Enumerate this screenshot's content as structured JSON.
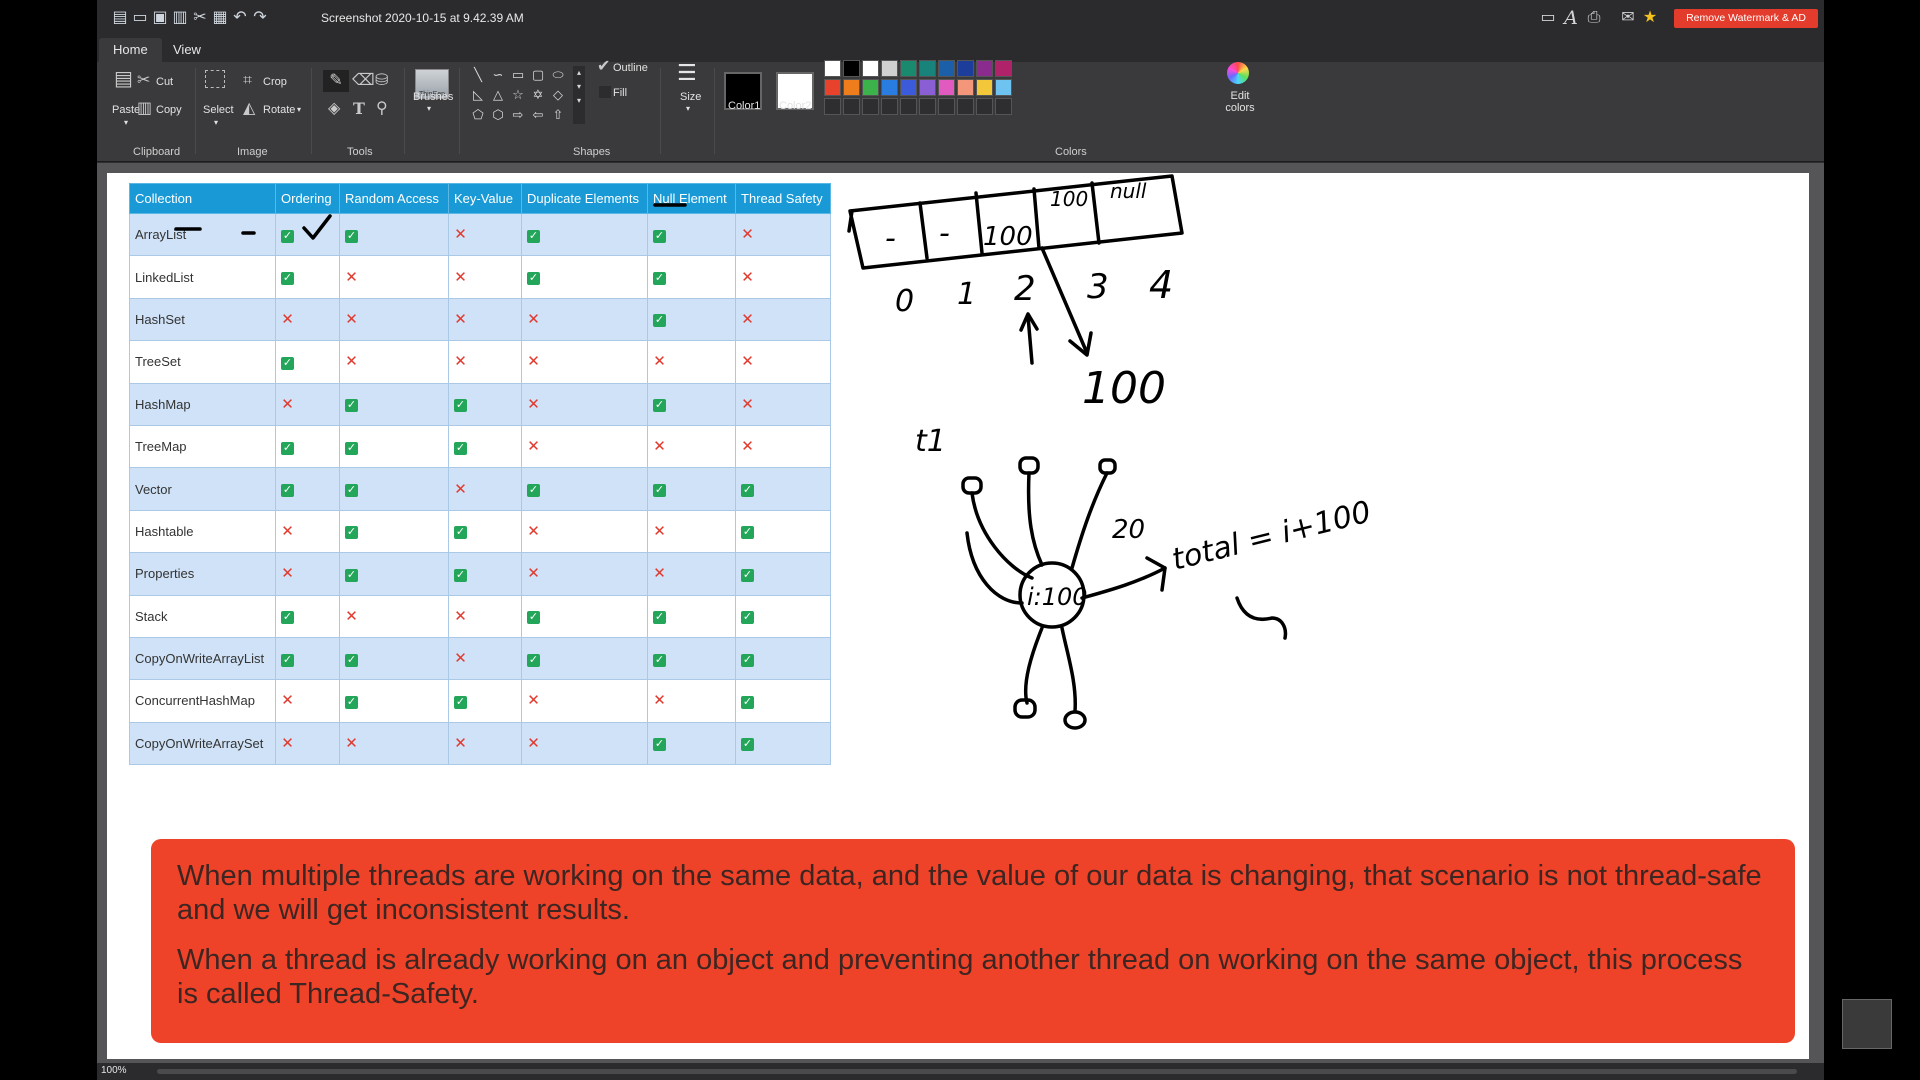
{
  "title": "Screenshot 2020-10-15 at 9.42.39 AM",
  "watermark_button": "Remove Watermark & AD",
  "menu_tabs": [
    "Home",
    "View"
  ],
  "ribbon": {
    "clipboard": {
      "paste": "Paste",
      "cut": "Cut",
      "copy": "Copy",
      "group": "Clipboard"
    },
    "image": {
      "select": "Select",
      "crop": "Crop",
      "rotate": "Rotate",
      "group": "Image"
    },
    "tools": {
      "group": "Tools"
    },
    "brushes": {
      "label": "Brushes",
      "preview": "ThinPen"
    },
    "shapes": {
      "group": "Shapes",
      "outline": "Outline",
      "fill": "Fill"
    },
    "size": {
      "label": "Size"
    },
    "colors": {
      "color1": "Color1",
      "color2": "Color2",
      "edit": "Edit colors",
      "group": "Colors"
    }
  },
  "palette_row1": [
    "#ffffff",
    "#000000",
    "#ffffff",
    "#d0d0d0",
    "#1a8a6e",
    "#17837a",
    "#1b5fa8",
    "#1d3d9a",
    "#8a2b8d",
    "#b0236b"
  ],
  "palette_row2": [
    "#e8412c",
    "#f07d1c",
    "#3cb24a",
    "#2a7de0",
    "#3b5bdb",
    "#8a5fd6",
    "#e05ac0",
    "#f3967a",
    "#f3c73a",
    "#6fc3f0"
  ],
  "table": {
    "headers": [
      "Collection",
      "Ordering",
      "Random Access",
      "Key-Value",
      "Duplicate Elements",
      "Null Element",
      "Thread Safety"
    ],
    "rows": [
      {
        "name": "ArrayList",
        "v": [
          1,
          1,
          0,
          1,
          1,
          0
        ]
      },
      {
        "name": "LinkedList",
        "v": [
          1,
          0,
          0,
          1,
          1,
          0
        ]
      },
      {
        "name": "HashSet",
        "v": [
          0,
          0,
          0,
          0,
          1,
          0
        ]
      },
      {
        "name": "TreeSet",
        "v": [
          1,
          0,
          0,
          0,
          0,
          0
        ]
      },
      {
        "name": "HashMap",
        "v": [
          0,
          1,
          1,
          0,
          1,
          0
        ]
      },
      {
        "name": "TreeMap",
        "v": [
          1,
          1,
          1,
          0,
          0,
          0
        ]
      },
      {
        "name": "Vector",
        "v": [
          1,
          1,
          0,
          1,
          1,
          1
        ]
      },
      {
        "name": "Hashtable",
        "v": [
          0,
          1,
          1,
          0,
          0,
          1
        ]
      },
      {
        "name": "Properties",
        "v": [
          0,
          1,
          1,
          0,
          0,
          1
        ]
      },
      {
        "name": "Stack",
        "v": [
          1,
          0,
          0,
          1,
          1,
          1
        ]
      },
      {
        "name": "CopyOnWriteArrayList",
        "v": [
          1,
          1,
          0,
          1,
          1,
          1
        ]
      },
      {
        "name": "ConcurrentHashMap",
        "v": [
          0,
          1,
          1,
          0,
          0,
          1
        ]
      },
      {
        "name": "CopyOnWriteArraySet",
        "v": [
          0,
          0,
          0,
          0,
          1,
          1
        ]
      }
    ]
  },
  "handwriting": {
    "array_cells": [
      "-",
      "-",
      "100",
      "100",
      "null"
    ],
    "indices": [
      "0",
      "1",
      "2",
      "3",
      "4"
    ],
    "value": "100",
    "thread_label": "t1",
    "object_label": "i:100",
    "value2": "20",
    "total": "total = i+100"
  },
  "info": {
    "p1": "When multiple threads are working on the same data, and the value of our data is changing, that scenario is not thread-safe and we will get inconsistent results.",
    "p2": "When a thread is already working on an object and preventing another thread on working on the same object, this process is called Thread-Safety."
  },
  "status": {
    "zoom": "100%"
  }
}
